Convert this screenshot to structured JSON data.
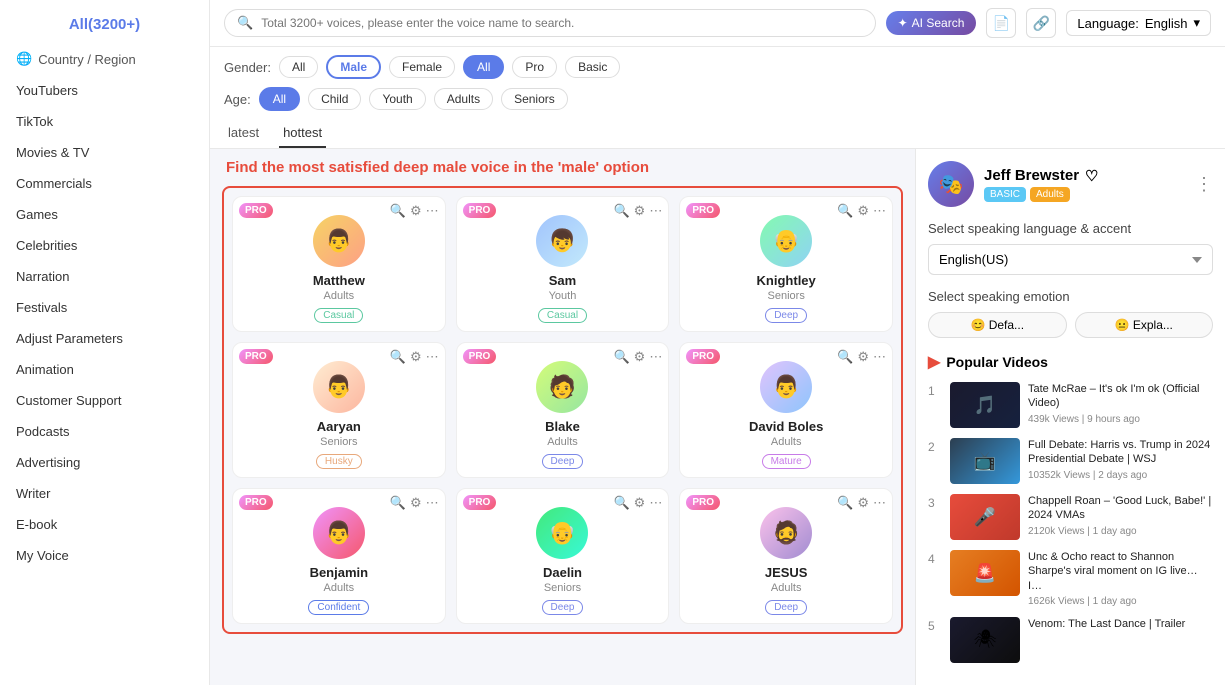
{
  "sidebar": {
    "title": "All(3200+)",
    "items": [
      {
        "id": "country-region",
        "label": "Country / Region",
        "icon": "🌐"
      },
      {
        "id": "youtubers",
        "label": "YouTubers"
      },
      {
        "id": "tiktok",
        "label": "TikTok"
      },
      {
        "id": "movies-tv",
        "label": "Movies & TV"
      },
      {
        "id": "commercials",
        "label": "Commercials"
      },
      {
        "id": "games",
        "label": "Games"
      },
      {
        "id": "celebrities",
        "label": "Celebrities"
      },
      {
        "id": "narration",
        "label": "Narration"
      },
      {
        "id": "festivals",
        "label": "Festivals"
      },
      {
        "id": "adjust-parameters",
        "label": "Adjust Parameters"
      },
      {
        "id": "animation",
        "label": "Animation"
      },
      {
        "id": "customer-support",
        "label": "Customer Support"
      },
      {
        "id": "podcasts",
        "label": "Podcasts"
      },
      {
        "id": "advertising",
        "label": "Advertising"
      },
      {
        "id": "writer",
        "label": "Writer"
      },
      {
        "id": "e-book",
        "label": "E-book"
      },
      {
        "id": "my-voice",
        "label": "My Voice"
      }
    ]
  },
  "topbar": {
    "search_placeholder": "Total 3200+ voices, please enter the voice name to search.",
    "ai_search_label": "AI Search",
    "language_label": "Language:",
    "language_value": "English"
  },
  "filters": {
    "gender_label": "Gender:",
    "gender_options": [
      "All",
      "Male",
      "Female"
    ],
    "gender_active": "Male",
    "tier_options": [
      "All",
      "Pro",
      "Basic"
    ],
    "tier_active": "All",
    "age_label": "Age:",
    "age_options": [
      "All",
      "Child",
      "Youth",
      "Adults",
      "Seniors"
    ],
    "age_active": "All"
  },
  "tabs": [
    {
      "id": "latest",
      "label": "latest"
    },
    {
      "id": "hottest",
      "label": "hottest"
    }
  ],
  "banner": "Find the most satisfied deep male voice in the 'male' option",
  "voices": [
    {
      "id": "matthew",
      "name": "Matthew",
      "age": "Adults",
      "tag": "Casual",
      "tag_type": "casual",
      "emoji": "👨"
    },
    {
      "id": "sam",
      "name": "Sam",
      "age": "Youth",
      "tag": "Casual",
      "tag_type": "casual",
      "emoji": "👦"
    },
    {
      "id": "knightley",
      "name": "Knightley",
      "age": "Seniors",
      "tag": "Deep",
      "tag_type": "deep",
      "emoji": "👴"
    },
    {
      "id": "aaryan",
      "name": "Aaryan",
      "age": "Seniors",
      "tag": "Husky",
      "tag_type": "husky",
      "emoji": "👨"
    },
    {
      "id": "blake",
      "name": "Blake",
      "age": "Adults",
      "tag": "Deep",
      "tag_type": "deep",
      "emoji": "🧑"
    },
    {
      "id": "david-boles",
      "name": "David Boles",
      "age": "Adults",
      "tag": "Mature",
      "tag_type": "mature",
      "emoji": "👨"
    },
    {
      "id": "benjamin",
      "name": "Benjamin",
      "age": "Adults",
      "tag": "Confident",
      "tag_type": "confident",
      "emoji": "👨"
    },
    {
      "id": "daelin",
      "name": "Daelin",
      "age": "Seniors",
      "tag": "Deep",
      "tag_type": "deep",
      "emoji": "👴"
    },
    {
      "id": "jesus",
      "name": "JESUS",
      "age": "Adults",
      "tag": "Deep",
      "tag_type": "deep",
      "emoji": "🧔"
    }
  ],
  "rightpanel": {
    "user": {
      "name": "Jeff Brewster",
      "heart": "♡",
      "badge_basic": "BASIC",
      "badge_adults": "Adults"
    },
    "language_section": "Select speaking language & accent",
    "language_option": "English(US)",
    "emotion_section": "Select speaking emotion",
    "emotions": [
      {
        "id": "default",
        "label": "😊 Defa..."
      },
      {
        "id": "explain",
        "label": "😐 Expla..."
      }
    ],
    "popular_title": "Popular Videos",
    "videos": [
      {
        "num": "1",
        "title": "Tate McRae – It's ok I'm ok (Official Video)",
        "meta": "439k Views | 9 hours ago",
        "class": "v1"
      },
      {
        "num": "2",
        "title": "Full Debate: Harris vs. Trump in 2024 Presidential Debate | WSJ",
        "meta": "10352k Views | 2 days ago",
        "class": "v2"
      },
      {
        "num": "3",
        "title": "Chappell Roan – 'Good Luck, Babe!' | 2024 VMAs",
        "meta": "2120k Views | 1 day ago",
        "class": "v3"
      },
      {
        "num": "4",
        "title": "Unc & Ocho react to Shannon Sharpe's viral moment on IG live… I…",
        "meta": "1626k Views | 1 day ago",
        "class": "v4"
      },
      {
        "num": "5",
        "title": "Venom: The Last Dance | Trailer",
        "meta": "",
        "class": "v5"
      }
    ]
  }
}
